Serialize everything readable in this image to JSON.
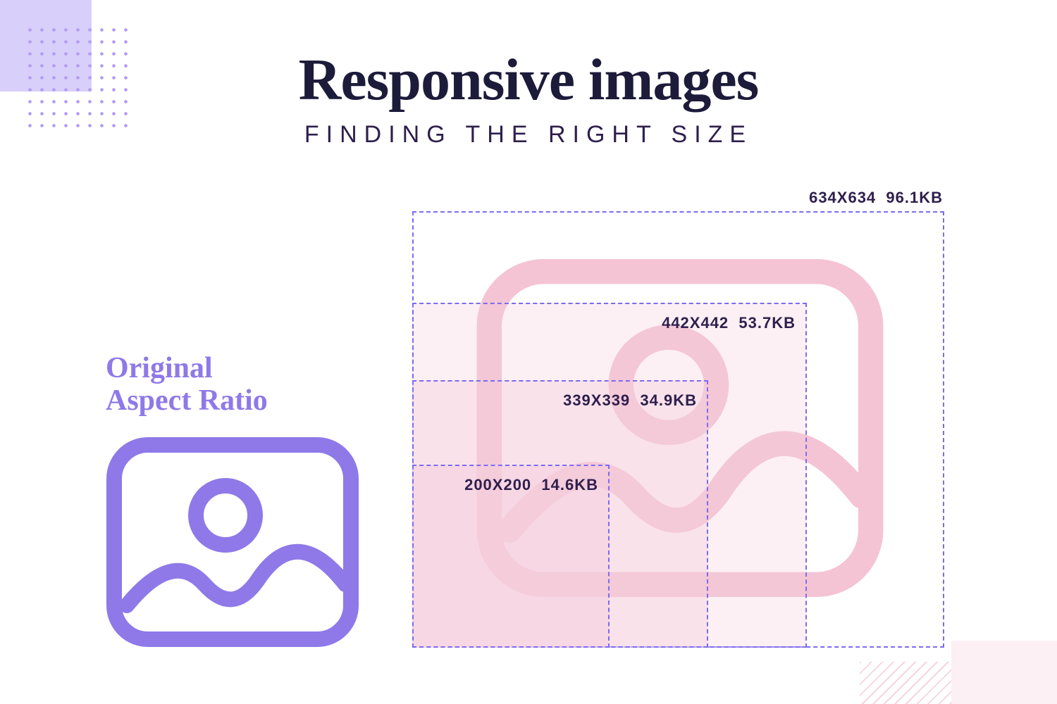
{
  "header": {
    "title": "Responsive images",
    "subtitle": "FINDING THE RIGHT SIZE"
  },
  "left": {
    "label_line1": "Original",
    "label_line2": "Aspect Ratio"
  },
  "sizes": [
    {
      "dimensions": "634X634",
      "filesize": "96.1KB"
    },
    {
      "dimensions": "442X442",
      "filesize": "53.7KB"
    },
    {
      "dimensions": "339X339",
      "filesize": "34.9KB"
    },
    {
      "dimensions": "200X200",
      "filesize": "14.6KB"
    }
  ],
  "colors": {
    "accent_purple": "#8f79e8",
    "dash_purple": "#7b6cf0",
    "pink": "#f4c4d4",
    "dark": "#1c1b3a"
  }
}
